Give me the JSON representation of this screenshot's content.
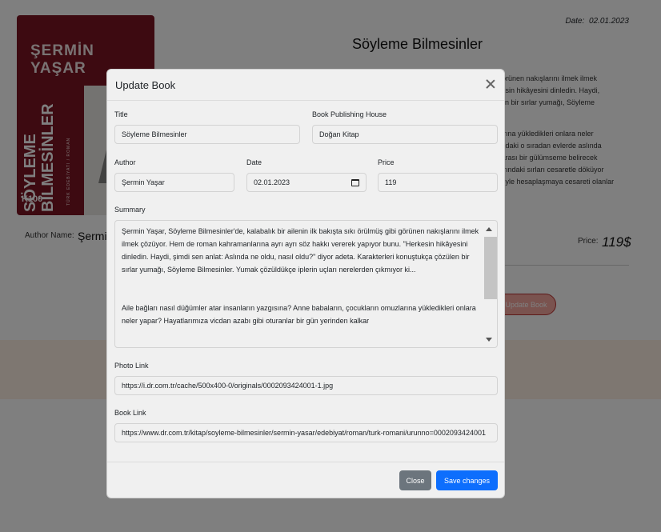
{
  "background": {
    "date_label": "Date:",
    "date_value": "02.01.2023",
    "title": "Söyleme Bilmesinler",
    "summary_lines": [
      "görünen nakışlarını ilmek ilmek",
      "kesin hikâyesini dinledin. Haydi,",
      "ilen bir sırlar yumağı, Söyleme",
      "",
      "larına yükledikleri onlara neler",
      "azdaki o sıradan evlerde aslında",
      "karası bir gülümseme belirecek",
      "larındaki sırları cesaretle döküyor",
      "züyle hesaplaşmaya cesareti olanlar"
    ],
    "author_label": "Author Name:",
    "author_value": "Şermin Yaşar",
    "price_label": "Price:",
    "price_value": "119$",
    "update_button": "Update Book",
    "cover": {
      "author": "ŞERMİN YAŞAR",
      "title_line1": "SÖYLEME",
      "title_line2": "BİLMESİNLER",
      "subtitle": "TÜRK EDEBİYATI / ROMAN",
      "logo": "K100"
    }
  },
  "modal": {
    "title": "Update Book",
    "fields": {
      "title_label": "Title",
      "title_value": "Söyleme Bilmesinler",
      "publisher_label": "Book Publishing House",
      "publisher_value": "Doğan Kitap",
      "author_label": "Author",
      "author_value": "Şermin Yaşar",
      "date_label": "Date",
      "date_value": "02.01.2023",
      "price_label": "Price",
      "price_value": "119",
      "summary_label": "Summary",
      "summary_value": "Şermin Yaşar, Söyleme Bilmesinler'de, kalabalık bir ailenin ilk bakışta sıkı örülmüş gibi görünen nakışlarını ilmek ilmek çözüyor. Hem de roman kahramanlarına ayrı ayrı söz hakkı vererek yapıyor bunu. \"Herkesin hikâyesini dinledin. Haydi, şimdi sen anlat: Aslında ne oldu, nasıl oldu?\" diyor adeta. Karakterleri konuştukça çözülen bir sırlar yumağı, Söyleme Bilmesinler. Yumak çözüldükçe iplerin uçları nerelerden çıkmıyor ki...\n\n\nAile bağları nasıl düğümler atar insanların yazgısına? Anne babaların, çocukların omuzlarına yükledikleri onlara neler yapar? Hayatlarımıza vicdan azabı gibi oturanlar bir gün yerinden kalkar",
      "photo_label": "Photo Link",
      "photo_value": "https://i.dr.com.tr/cache/500x400-0/originals/0002093424001-1.jpg",
      "link_label": "Book Link",
      "link_value": "https://www.dr.com.tr/kitap/soyleme-bilmesinler/sermin-yasar/edebiyat/roman/turk-romani/urunno=0002093424001"
    },
    "buttons": {
      "close": "Close",
      "save": "Save changes"
    }
  },
  "colors": {
    "primary": "#0d6efd",
    "secondary": "#6c757d",
    "cover": "#7a1422"
  }
}
